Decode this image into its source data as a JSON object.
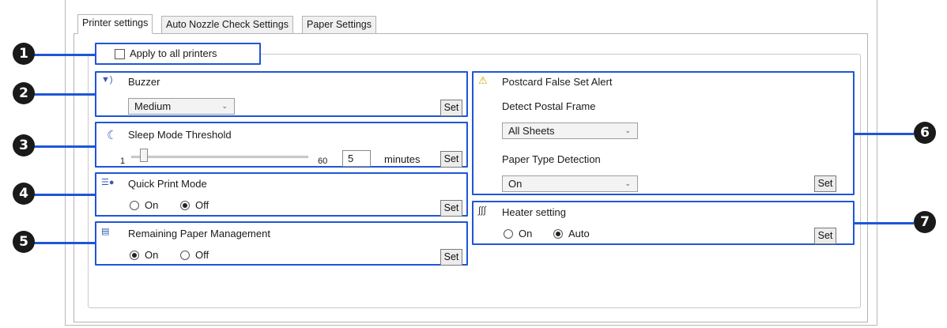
{
  "tabs": [
    {
      "label": "Printer settings",
      "active": true
    },
    {
      "label": "Auto Nozzle Check Settings",
      "active": false
    },
    {
      "label": "Paper Settings",
      "active": false
    }
  ],
  "callouts": [
    "1",
    "2",
    "3",
    "4",
    "5",
    "6",
    "7"
  ],
  "apply_all": {
    "label": "Apply to all printers",
    "checked": false
  },
  "buzzer": {
    "title": "Buzzer",
    "value": "Medium",
    "set_label": "Set",
    "icon": "speaker-icon"
  },
  "sleep": {
    "title": "Sleep Mode Threshold",
    "min_label": "1",
    "max_label": "60",
    "value": "5",
    "unit": "minutes",
    "set_label": "Set",
    "slider_fraction": 0.07,
    "icon": "moon-icon"
  },
  "quick_print": {
    "title": "Quick Print Mode",
    "on_label": "On",
    "off_label": "Off",
    "selected": "Off",
    "set_label": "Set",
    "icon": "quick-print-icon"
  },
  "remaining_paper": {
    "title": "Remaining Paper Management",
    "on_label": "On",
    "off_label": "Off",
    "selected": "On",
    "set_label": "Set",
    "icon": "paper-icon"
  },
  "postcard": {
    "title": "Postcard False Set Alert",
    "detect_label": "Detect Postal Frame",
    "detect_value": "All Sheets",
    "paper_type_label": "Paper Type Detection",
    "paper_type_value": "On",
    "set_label": "Set",
    "icon": "warning-icon"
  },
  "heater": {
    "title": "Heater setting",
    "on_label": "On",
    "auto_label": "Auto",
    "selected": "Auto",
    "set_label": "Set",
    "icon": "heater-icon"
  },
  "colors": {
    "highlight": "#1f56d6",
    "badge": "#1a1a1a"
  }
}
